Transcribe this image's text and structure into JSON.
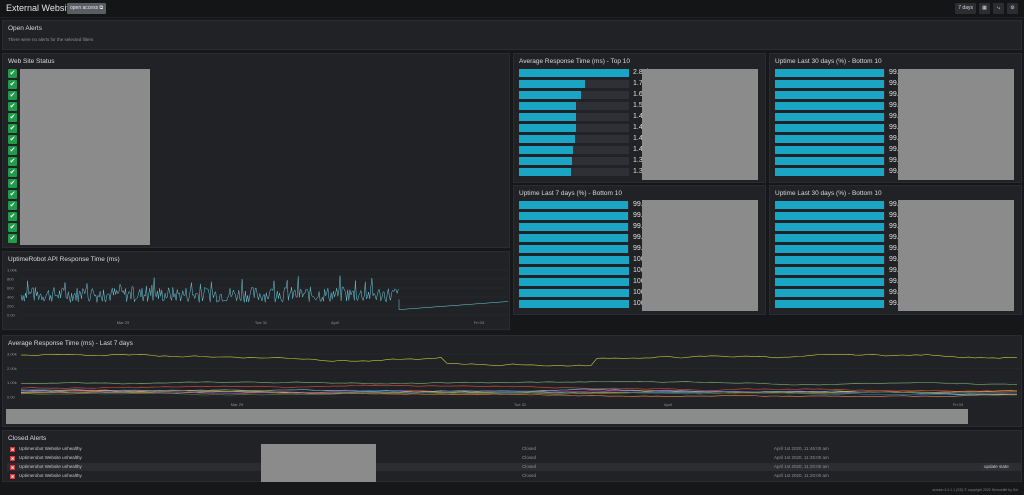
{
  "header": {
    "title": "External Websites",
    "open_access_label": "open access",
    "time_range": "7 days"
  },
  "open_alerts": {
    "title": "Open Alerts",
    "empty_text": "There were no alerts for the selected filters"
  },
  "web_site_status": {
    "title": "Web Site Status",
    "count": 16
  },
  "api_response": {
    "title": "UptimeRobot API Response Time (ms)",
    "chart_data": {
      "type": "line",
      "y_ticks": [
        "1.00k",
        "800",
        "600",
        "400",
        "200",
        "0.00"
      ],
      "x_ticks": [
        "Mar 29",
        "Tue 31",
        "April",
        "Fri 03"
      ],
      "ylim": [
        0,
        1000
      ]
    }
  },
  "avg_top10": {
    "title": "Average Response Time (ms) - Top 10",
    "chart_data": {
      "type": "bar",
      "values": [
        2870,
        1730,
        1620,
        1500,
        1490,
        1480,
        1460,
        1420,
        1370,
        1360
      ],
      "labels": [
        "2.87k",
        "1.73k",
        "1.62k",
        "1.50k",
        "1.49k",
        "1.48k",
        "1.46k",
        "1.42k",
        "1.37k",
        "1.36k"
      ],
      "max": 2870
    }
  },
  "uptime30_a": {
    "title": "Uptime Last 30 days (%) - Bottom 10",
    "chart_data": {
      "type": "bar",
      "values": [
        99.0,
        99.0,
        99.0,
        99.0,
        99.0,
        99.0,
        99.0,
        99.0,
        99.0,
        99.0
      ],
      "labels": [
        "99.0",
        "99.0",
        "99.0",
        "99.0",
        "99.0",
        "99.0",
        "99.0",
        "99.0",
        "99.0",
        "99.0"
      ],
      "max": 100
    }
  },
  "uptime7": {
    "title": "Uptime Last 7 days (%) - Bottom 10",
    "chart_data": {
      "type": "bar",
      "values": [
        99.0,
        99.0,
        99.0,
        99.0,
        99.0,
        100,
        100,
        100,
        100,
        100
      ],
      "labels": [
        "99.0",
        "99.0",
        "99.0",
        "99.0",
        "99.0",
        "100",
        "100",
        "100",
        "100",
        "100"
      ],
      "max": 100
    }
  },
  "uptime30_b": {
    "title": "Uptime Last 30 days (%) - Bottom 10",
    "chart_data": {
      "type": "bar",
      "values": [
        99.0,
        99.0,
        99.0,
        99.0,
        99.0,
        99.0,
        99.0,
        99.0,
        99.0,
        99.0
      ],
      "labels": [
        "99.0",
        "99.0",
        "99.0",
        "99.0",
        "99.0",
        "99.0",
        "99.0",
        "99.0",
        "99.0",
        "99.0"
      ],
      "max": 100
    }
  },
  "avg_7days": {
    "title": "Average Response Time (ms) - Last 7 days",
    "chart_data": {
      "type": "line",
      "y_ticks": [
        "3.00k",
        "2.00k",
        "1.00k",
        "0.00"
      ],
      "x_ticks": [
        "Mar 29",
        "Tue 31",
        "April",
        "Fri 03"
      ],
      "ylim": [
        0,
        3000
      ],
      "series_colors": [
        "#c8c93a",
        "#7eb26d",
        "#e24d42",
        "#1f78c1",
        "#ba43a9",
        "#6ed0e0",
        "#ef843c",
        "#e5ac0e",
        "#705da0",
        "#508642"
      ]
    }
  },
  "closed_alerts": {
    "title": "Closed Alerts",
    "update_label": "update state",
    "rows": [
      {
        "name": "Uptimerobot Website unhealthy",
        "state": "Closed",
        "time": "April 1st 2020, 11:46:00 am"
      },
      {
        "name": "Uptimerobot Website unhealthy",
        "state": "Closed",
        "time": "April 1st 2020, 11:25:00 am"
      },
      {
        "name": "Uptimerobot Website unhealthy",
        "state": "Closed",
        "time": "April 1st 2020, 11:20:00 am"
      },
      {
        "name": "Uptimerobot Website unhealthy",
        "state": "Closed",
        "time": "April 1st 2020, 11:20:00 am"
      }
    ]
  },
  "footer": {
    "text": "version 4.0.1.1 (SD) © copyright 2020 Sensorfiel by Sol"
  },
  "colors": {
    "accent": "#1aa5c4",
    "ok": "#1f9b4a",
    "alert": "#d33c3c"
  }
}
